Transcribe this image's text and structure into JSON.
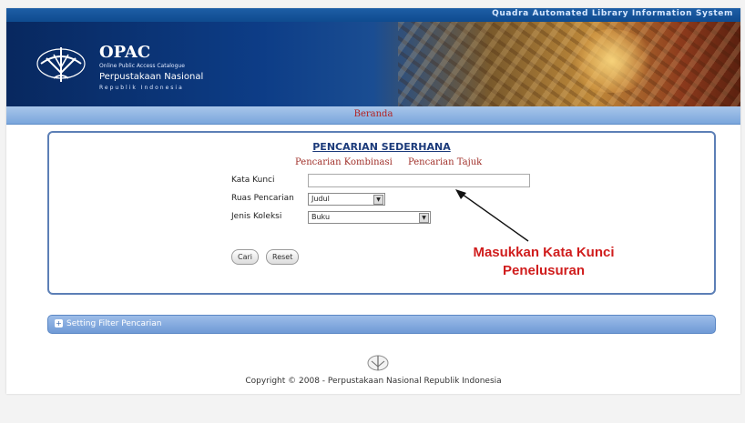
{
  "header": {
    "system_title": "Quadra Automated Library Information System",
    "app_name": "OPAC",
    "app_subtitle": "Online Public Access Catalogue",
    "library_name": "Perpustakaan Nasional",
    "country": "Republik Indonesia"
  },
  "nav": {
    "home": "Beranda"
  },
  "search": {
    "title": "PENCARIAN SEDERHANA",
    "tabs": [
      "Pencarian Kombinasi",
      "Pencarian Tajuk"
    ],
    "keyword_label": "Kata Kunci",
    "keyword_value": "",
    "field_label": "Ruas Pencarian",
    "field_value": "Judul",
    "collection_label": "Jenis Koleksi",
    "collection_value": "Buku",
    "search_button": "Cari",
    "reset_button": "Reset"
  },
  "annotation": {
    "line1": "Masukkan Kata Kunci",
    "line2": "Penelusuran"
  },
  "filter": {
    "label": "Setting Filter Pencarian"
  },
  "footer": {
    "copyright": "Copyright © 2008 - Perpustakaan Nasional Republik Indonesia"
  },
  "colors": {
    "accent": "#1b3a7a",
    "annotation": "#d01d1d",
    "nav_text": "#b22222"
  },
  "icons": {
    "logo": "opac-book-tree-logo",
    "arrow": "annotation-arrow",
    "expand": "expand-plus-icon"
  }
}
